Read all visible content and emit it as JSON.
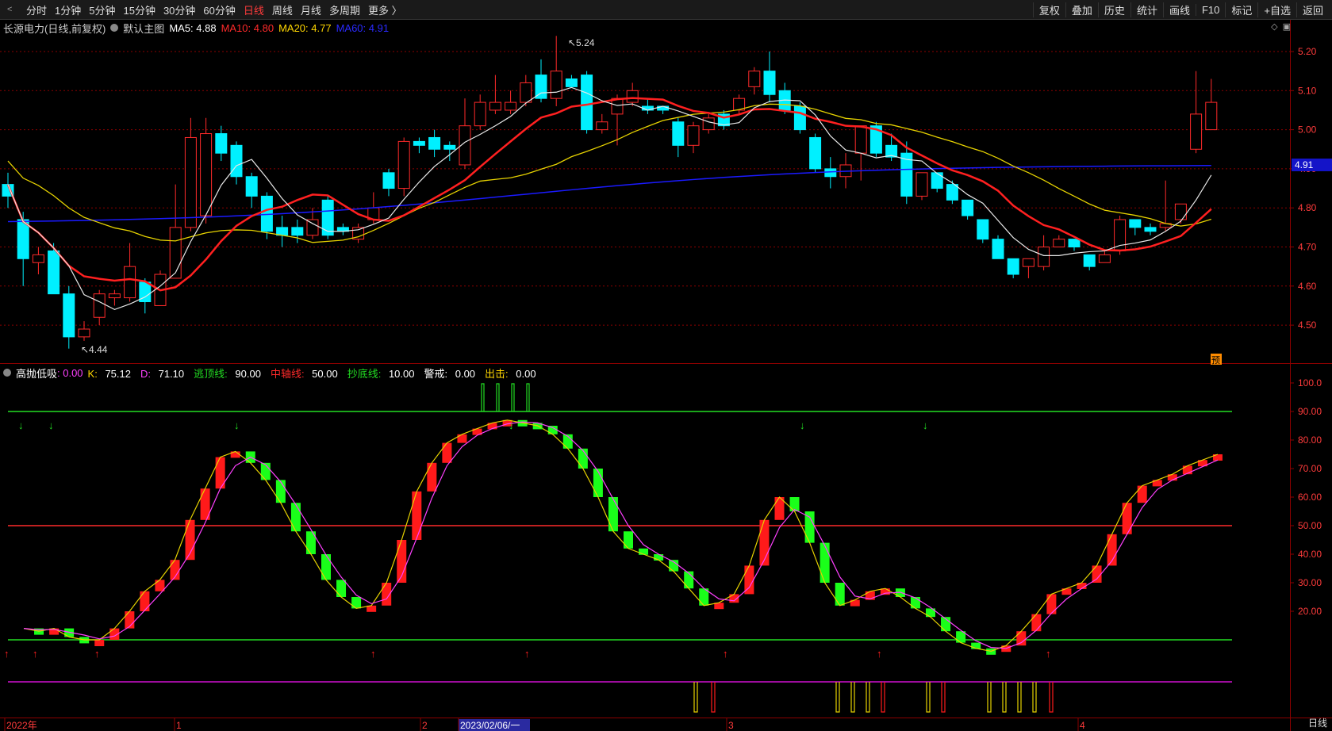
{
  "toolbar": {
    "back": "<",
    "periods": [
      "分时",
      "1分钟",
      "5分钟",
      "15分钟",
      "30分钟",
      "60分钟",
      "日线",
      "周线",
      "月线",
      "多周期",
      "更多 〉"
    ],
    "active_period": "日线",
    "right_buttons": [
      "复权",
      "叠加",
      "历史",
      "统计",
      "画线",
      "F10",
      "标记",
      "+自选",
      "返回"
    ]
  },
  "main_chart": {
    "stock": "长源电力",
    "mode": "(日线,前复权)",
    "template": "默认主图",
    "ma": [
      {
        "label": "MA5:",
        "value": "4.88",
        "color": "#ffffff"
      },
      {
        "label": "MA10:",
        "value": "4.80",
        "color": "#ff2a2a"
      },
      {
        "label": "MA20:",
        "value": "4.77",
        "color": "#ffd700"
      },
      {
        "label": "MA60:",
        "value": "4.91",
        "color": "#2a2aff"
      }
    ],
    "price_ticks": [
      "5.20",
      "5.10",
      "5.00",
      "4.90",
      "4.80",
      "4.70",
      "4.60",
      "4.50"
    ],
    "last_price_tag": "4.91",
    "high_mark": "5.24",
    "low_mark": "4.44",
    "forecast_mark": "预"
  },
  "sub_chart": {
    "name": "高抛低吸",
    "name_value": ": 0.00",
    "indicators": [
      {
        "label": "K:",
        "value": "75.12",
        "color": "#ffd700"
      },
      {
        "label": "D:",
        "value": "71.10",
        "color": "#ff40ff"
      },
      {
        "label": "逃顶线:",
        "value": "90.00",
        "color": "#22dd22"
      },
      {
        "label": "中轴线:",
        "value": "50.00",
        "color": "#ff2a2a"
      },
      {
        "label": "抄底线:",
        "value": "10.00",
        "color": "#22dd22"
      },
      {
        "label": "警戒:",
        "value": "0.00",
        "color": "#ffffff"
      },
      {
        "label": "出击:",
        "value": "0.00",
        "color": "#ffd700"
      }
    ],
    "value_ticks": [
      "100.0",
      "90.00",
      "80.00",
      "70.00",
      "60.00",
      "50.00",
      "40.00",
      "30.00",
      "20.00"
    ]
  },
  "time_axis": {
    "labels": [
      "2022年",
      "1",
      "2",
      "2023/02/06/一",
      "3",
      "4"
    ],
    "period": "日线"
  },
  "colors": {
    "up": "#ff2a2a",
    "down": "#00f0ff",
    "green": "#22dd22",
    "grid": "#8b0000"
  },
  "candles": [
    [
      4.83,
      4.86,
      4.8,
      4.89,
      0
    ],
    [
      4.77,
      4.67,
      4.6,
      4.79,
      0
    ],
    [
      4.66,
      4.68,
      4.63,
      4.7,
      1
    ],
    [
      4.69,
      4.58,
      4.58,
      4.71,
      0
    ],
    [
      4.58,
      4.47,
      4.44,
      4.6,
      0
    ],
    [
      4.47,
      4.49,
      4.46,
      4.51,
      1
    ],
    [
      4.52,
      4.58,
      4.5,
      4.59,
      1
    ],
    [
      4.57,
      4.58,
      4.55,
      4.59,
      1
    ],
    [
      4.57,
      4.65,
      4.56,
      4.71,
      1
    ],
    [
      4.61,
      4.56,
      4.53,
      4.62,
      0
    ],
    [
      4.55,
      4.63,
      4.55,
      4.64,
      1
    ],
    [
      4.62,
      4.75,
      4.62,
      4.86,
      1
    ],
    [
      4.75,
      4.98,
      4.74,
      5.03,
      1
    ],
    [
      4.78,
      4.99,
      4.76,
      5.03,
      1
    ],
    [
      4.99,
      4.94,
      4.92,
      5.01,
      0
    ],
    [
      4.96,
      4.88,
      4.86,
      4.97,
      0
    ],
    [
      4.88,
      4.83,
      4.8,
      4.89,
      0
    ],
    [
      4.83,
      4.74,
      4.72,
      4.84,
      0
    ],
    [
      4.75,
      4.73,
      4.7,
      4.78,
      0
    ],
    [
      4.75,
      4.73,
      4.71,
      4.77,
      0
    ],
    [
      4.73,
      4.77,
      4.72,
      4.8,
      1
    ],
    [
      4.82,
      4.73,
      4.72,
      4.83,
      0
    ],
    [
      4.75,
      4.74,
      4.73,
      4.76,
      0
    ],
    [
      4.72,
      4.75,
      4.71,
      4.76,
      1
    ],
    [
      4.77,
      4.8,
      4.76,
      4.84,
      1
    ],
    [
      4.89,
      4.85,
      4.83,
      4.9,
      0
    ],
    [
      4.85,
      4.97,
      4.83,
      4.98,
      1
    ],
    [
      4.97,
      4.96,
      4.94,
      4.98,
      0
    ],
    [
      4.98,
      4.95,
      4.93,
      5.0,
      0
    ],
    [
      4.96,
      4.95,
      4.92,
      4.97,
      0
    ],
    [
      4.91,
      5.01,
      4.9,
      5.08,
      1
    ],
    [
      5.01,
      5.07,
      5.0,
      5.09,
      1
    ],
    [
      5.05,
      5.07,
      5.04,
      5.14,
      1
    ],
    [
      5.05,
      5.07,
      5.04,
      5.1,
      1
    ],
    [
      5.07,
      5.12,
      5.06,
      5.14,
      1
    ],
    [
      5.08,
      5.14,
      5.07,
      5.18,
      0
    ],
    [
      5.15,
      5.08,
      5.06,
      5.24,
      1
    ],
    [
      5.11,
      5.13,
      5.12,
      5.14,
      0
    ],
    [
      5.14,
      5.0,
      4.99,
      5.15,
      0
    ],
    [
      5.0,
      5.02,
      4.99,
      5.04,
      1
    ],
    [
      5.04,
      5.08,
      4.96,
      5.09,
      1
    ],
    [
      5.07,
      5.1,
      5.06,
      5.12,
      1
    ],
    [
      5.06,
      5.05,
      5.04,
      5.08,
      0
    ],
    [
      5.06,
      5.05,
      5.04,
      5.06,
      0
    ],
    [
      5.02,
      4.96,
      4.93,
      5.03,
      0
    ],
    [
      4.96,
      5.01,
      4.94,
      5.02,
      1
    ],
    [
      5.0,
      5.03,
      4.99,
      5.04,
      1
    ],
    [
      5.04,
      5.01,
      5.0,
      5.05,
      0
    ],
    [
      5.05,
      5.08,
      5.04,
      5.09,
      1
    ],
    [
      5.11,
      5.15,
      5.09,
      5.16,
      1
    ],
    [
      5.15,
      5.09,
      5.07,
      5.2,
      0
    ],
    [
      5.1,
      5.05,
      5.04,
      5.12,
      0
    ],
    [
      5.06,
      5.0,
      4.99,
      5.07,
      0
    ],
    [
      4.98,
      4.9,
      4.89,
      4.99,
      0
    ],
    [
      4.9,
      4.88,
      4.85,
      4.93,
      0
    ],
    [
      4.88,
      4.91,
      4.85,
      4.94,
      1
    ],
    [
      4.94,
      5.01,
      4.87,
      5.01,
      1
    ],
    [
      5.01,
      4.94,
      4.93,
      5.02,
      0
    ],
    [
      4.96,
      4.93,
      4.92,
      4.99,
      0
    ],
    [
      4.94,
      4.83,
      4.81,
      4.97,
      0
    ],
    [
      4.83,
      4.89,
      4.82,
      4.89,
      1
    ],
    [
      4.89,
      4.85,
      4.84,
      4.89,
      0
    ],
    [
      4.86,
      4.82,
      4.81,
      4.87,
      0
    ],
    [
      4.82,
      4.78,
      4.77,
      4.82,
      0
    ],
    [
      4.77,
      4.72,
      4.71,
      4.77,
      0
    ],
    [
      4.72,
      4.67,
      4.67,
      4.73,
      0
    ],
    [
      4.67,
      4.63,
      4.62,
      4.67,
      0
    ],
    [
      4.65,
      4.67,
      4.62,
      4.67,
      1
    ],
    [
      4.65,
      4.7,
      4.64,
      4.73,
      1
    ],
    [
      4.7,
      4.72,
      4.7,
      4.73,
      1
    ],
    [
      4.72,
      4.7,
      4.69,
      4.72,
      0
    ],
    [
      4.68,
      4.65,
      4.64,
      4.68,
      0
    ],
    [
      4.66,
      4.68,
      4.66,
      4.69,
      1
    ],
    [
      4.69,
      4.77,
      4.68,
      4.78,
      1
    ],
    [
      4.77,
      4.75,
      4.73,
      4.77,
      0
    ],
    [
      4.75,
      4.74,
      4.73,
      4.76,
      0
    ],
    [
      4.75,
      4.76,
      4.74,
      4.87,
      1
    ],
    [
      4.77,
      4.81,
      4.76,
      4.81,
      1
    ],
    [
      4.95,
      5.04,
      4.94,
      5.15,
      1
    ],
    [
      5.0,
      5.07,
      5.0,
      5.13,
      1
    ]
  ]
}
